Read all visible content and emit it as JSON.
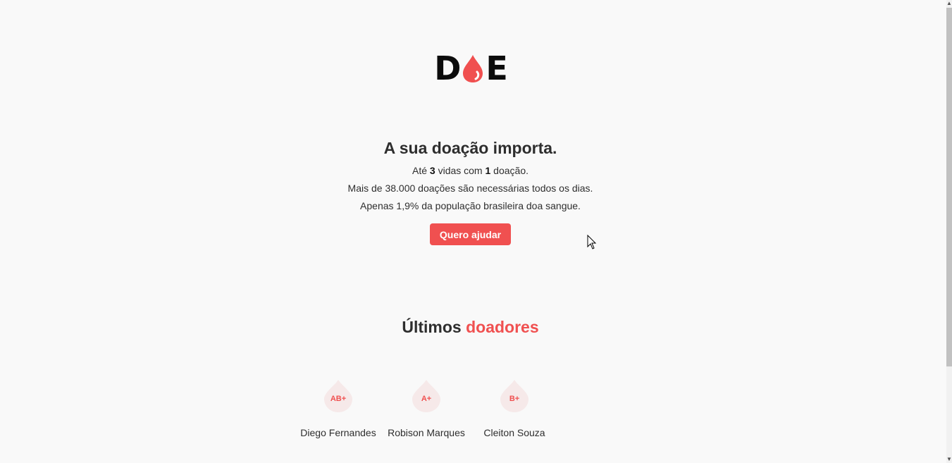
{
  "logo": {
    "letter_left": "D",
    "letter_right": "E",
    "drop_color": "#f05050",
    "icon": "blood-drop-icon"
  },
  "hero": {
    "title": "A sua doação importa.",
    "line1": {
      "pre": "Até ",
      "bold1": "3",
      "mid": " vidas com ",
      "bold2": "1",
      "post": " doação."
    },
    "line2": "Mais de 38.000 doações são necessárias todos os dias.",
    "line3": "Apenas 1,9% da população brasileira doa sangue.",
    "cta_label": "Quero ajudar"
  },
  "donors_section": {
    "title_plain": "Últimos ",
    "title_accent": "doadores",
    "donors": [
      {
        "blood_type": "AB+",
        "name": "Diego Fernandes"
      },
      {
        "blood_type": "A+",
        "name": "Robison Marques"
      },
      {
        "blood_type": "B+",
        "name": "Cleiton Souza"
      }
    ]
  },
  "colors": {
    "accent": "#f05050",
    "background": "#f9f9f9",
    "text": "#2e2e2e",
    "drop_badge": "#f6e9e9"
  }
}
